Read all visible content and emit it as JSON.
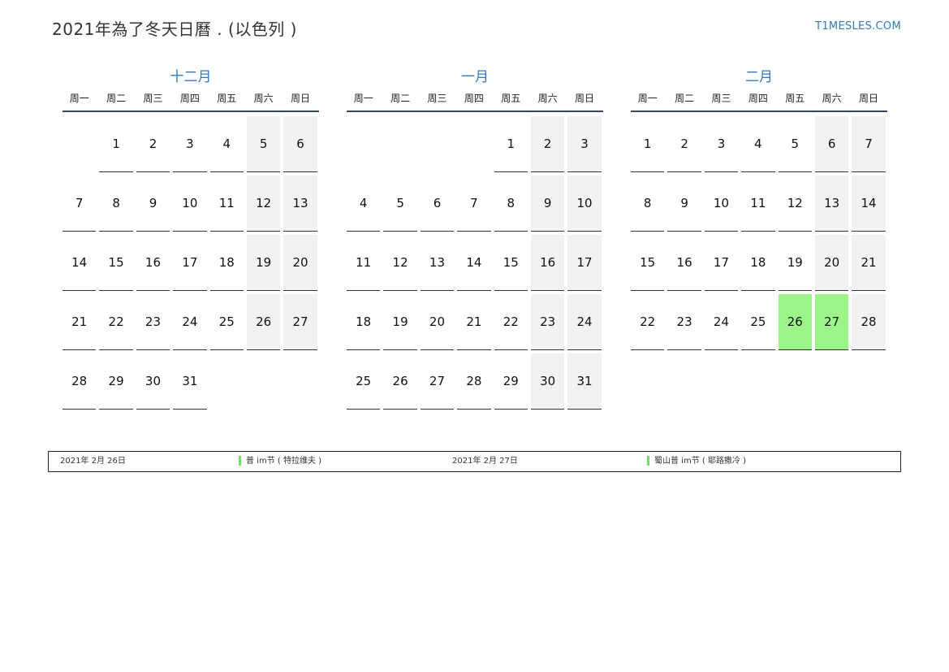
{
  "header": {
    "title": "2021年為了冬天日曆 . (以色列 )",
    "site": "T1MESLES.COM"
  },
  "colors": {
    "accent": "#2e7bbf",
    "weekend_bg": "#f2f2f2",
    "holiday_bg": "#9df58a",
    "rule": "#2f4763"
  },
  "weekdays": [
    "周一",
    "周二",
    "周三",
    "周四",
    "周五",
    "周六",
    "周日"
  ],
  "months": [
    {
      "name": "十二月",
      "weeks": [
        [
          "",
          "1",
          "2",
          "3",
          "4",
          "5",
          "6"
        ],
        [
          "7",
          "8",
          "9",
          "10",
          "11",
          "12",
          "13"
        ],
        [
          "14",
          "15",
          "16",
          "17",
          "18",
          "19",
          "20"
        ],
        [
          "21",
          "22",
          "23",
          "24",
          "25",
          "26",
          "27"
        ],
        [
          "28",
          "29",
          "30",
          "31",
          "",
          "",
          ""
        ]
      ],
      "holidays": []
    },
    {
      "name": "一月",
      "weeks": [
        [
          "",
          "",
          "",
          "",
          "1",
          "2",
          "3"
        ],
        [
          "4",
          "5",
          "6",
          "7",
          "8",
          "9",
          "10"
        ],
        [
          "11",
          "12",
          "13",
          "14",
          "15",
          "16",
          "17"
        ],
        [
          "18",
          "19",
          "20",
          "21",
          "22",
          "23",
          "24"
        ],
        [
          "25",
          "26",
          "27",
          "28",
          "29",
          "30",
          "31"
        ]
      ],
      "holidays": []
    },
    {
      "name": "二月",
      "weeks": [
        [
          "1",
          "2",
          "3",
          "4",
          "5",
          "6",
          "7"
        ],
        [
          "8",
          "9",
          "10",
          "11",
          "12",
          "13",
          "14"
        ],
        [
          "15",
          "16",
          "17",
          "18",
          "19",
          "20",
          "21"
        ],
        [
          "22",
          "23",
          "24",
          "25",
          "26",
          "27",
          "28"
        ]
      ],
      "holidays": [
        "26",
        "27"
      ]
    }
  ],
  "legend": [
    {
      "date": "2021年 2月 26日",
      "name": "普 im节 ( 特拉维夫 )"
    },
    {
      "date": "2021年 2月 27日",
      "name": "蜀山普 im节 ( 耶路撒冷 )"
    }
  ]
}
